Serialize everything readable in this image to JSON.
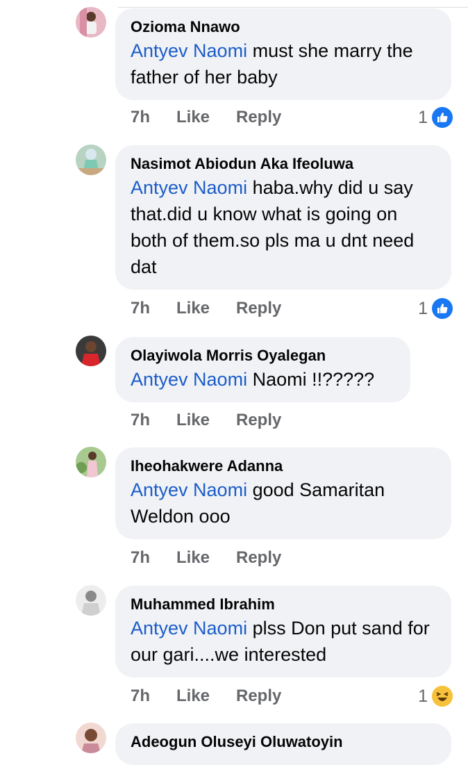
{
  "comments": [
    {
      "author": "Ozioma Nnawo",
      "mention": "Antyev Naomi",
      "text": " must she marry the father of her baby",
      "time": "7h",
      "like_label": "Like",
      "reply_label": "Reply",
      "reaction_count": "1",
      "reaction_icon": "like-icon"
    },
    {
      "author": "Nasimot Abiodun Aka Ifeoluwa",
      "mention": "Antyev Naomi",
      "text": " haba.why  did u say that.did u know what is going on both of them.so pls ma u dnt need dat",
      "time": "7h",
      "like_label": "Like",
      "reply_label": "Reply",
      "reaction_count": "1",
      "reaction_icon": "like-icon"
    },
    {
      "author": "Olayiwola Morris Oyalegan",
      "mention": "Antyev Naomi",
      "text": " Naomi !!?????",
      "time": "7h",
      "like_label": "Like",
      "reply_label": "Reply"
    },
    {
      "author": "Iheohakwere Adanna",
      "mention": "Antyev Naomi",
      "text": " good Samaritan Weldon ooo",
      "time": "7h",
      "like_label": "Like",
      "reply_label": "Reply"
    },
    {
      "author": "Muhammed Ibrahim",
      "mention": "Antyev Naomi",
      "text": " plss Don put sand for our gari....we interested",
      "time": "7h",
      "like_label": "Like",
      "reply_label": "Reply",
      "reaction_count": "1",
      "reaction_icon": "haha-icon"
    },
    {
      "author": "Adeogun Oluseyi Oluwatoyin"
    }
  ],
  "colors": {
    "mention": "#1b5cc9",
    "bubble": "#f0f2f5",
    "meta": "#65676b",
    "like_blue": "#1877f2"
  }
}
